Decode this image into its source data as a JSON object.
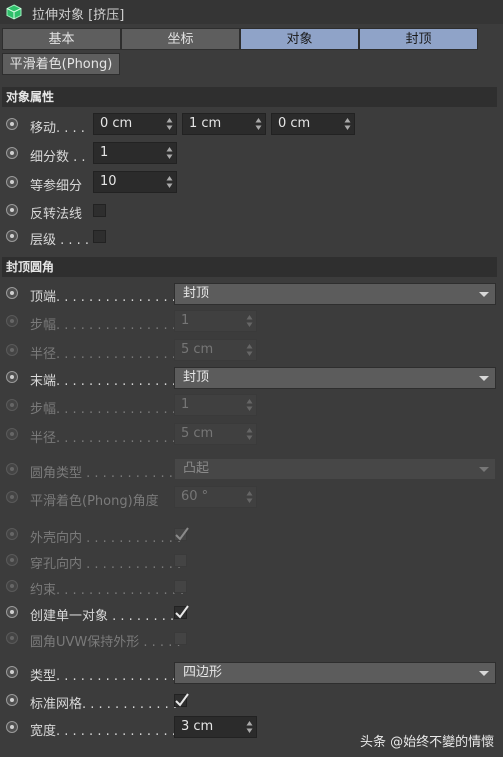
{
  "window": {
    "title": "拉伸对象 [挤压]"
  },
  "tabs": [
    {
      "label": "基本",
      "active": false
    },
    {
      "label": "坐标",
      "active": false
    },
    {
      "label": "对象",
      "active": true
    },
    {
      "label": "封顶",
      "active": true
    }
  ],
  "tab_phong": "平滑着色(Phong)",
  "sections": {
    "object_props": "对象属性",
    "cap_rounding": "封顶圆角"
  },
  "object": {
    "move_label": "移动. . . .",
    "move_values": [
      "0 cm",
      "1 cm",
      "0 cm"
    ],
    "subdiv_label": "细分数 . .",
    "subdiv_value": "1",
    "isoparm_label": "等参细分",
    "isoparm_value": "10",
    "flip_normals_label": "反转法线",
    "flip_normals_checked": false,
    "hierarchy_label": "层级 . . . .",
    "hierarchy_checked": false
  },
  "caps": {
    "start_label": "顶端. . . . . . . . . . . . . . . .",
    "start_value": "封顶",
    "start_steps_label": "步幅. . . . . . . . . . . . . . . .",
    "start_steps_value": "1",
    "start_radius_label": "半径. . . . . . . . . . . . . . . .",
    "start_radius_value": "5 cm",
    "end_label": "末端. . . . . . . . . . . . . . . .",
    "end_value": "封顶",
    "end_steps_label": "步幅. . . . . . . . . . . . . . . .",
    "end_steps_value": "1",
    "end_radius_label": "半径. . . . . . . . . . . . . . . .",
    "end_radius_value": "5 cm",
    "fillet_type_label": "圆角类型 . . . . . . . . . . . .",
    "fillet_type_value": "凸起",
    "phong_angle_label": "平滑着色(Phong)角度",
    "phong_angle_value": "60 °",
    "hull_inward_label": "外壳向内 . . . . . . . . . . . .",
    "hull_inward_checked": true,
    "hole_inward_label": "穿孔向内 . . . . . . . . . . . .",
    "hole_inward_checked": false,
    "constrain_label": "约束. . . . . . . . . . . . . . . .",
    "constrain_checked": false,
    "single_object_label": "创建单一对象 . . . . . . . .",
    "single_object_checked": true,
    "uvw_label": "圆角UVW保持外形 . . . . .",
    "uvw_checked": false,
    "type_label": "类型. . . . . . . . . . . . . . . .",
    "type_value": "四边形",
    "std_grid_label": "标准网格. . . . . . . . . . . .",
    "std_grid_checked": true,
    "width_label": "宽度. . . . . . . . . . . . . . . .",
    "width_value": "3 cm"
  },
  "watermark": "头条 @始终不變的情懷",
  "colors": {
    "active_tab": "#8fa3c8",
    "panel_bg": "#3c3c3c",
    "section_bg": "#2f2f2f"
  }
}
